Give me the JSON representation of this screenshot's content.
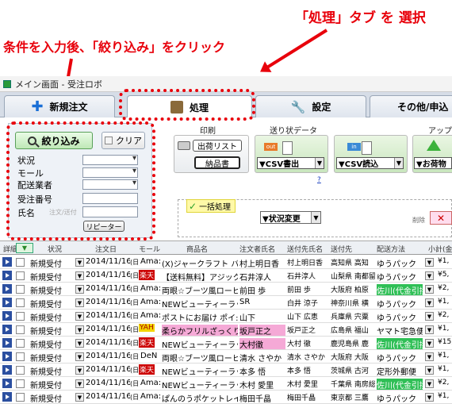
{
  "annotations": {
    "tab_instruction": "「処理」タブ を 選択",
    "filter_instruction": "条件を入力後、「絞り込み」をクリック"
  },
  "window": {
    "title": "メイン画面 - 受注ロボ"
  },
  "tabs": [
    {
      "label": "新規注文",
      "icon": "plus-icon"
    },
    {
      "label": "処理",
      "icon": "box-icon"
    },
    {
      "label": "設定",
      "icon": "wrench-icon"
    },
    {
      "label": "その他/申込",
      "icon": ""
    }
  ],
  "filter": {
    "filter_button": "絞り込み",
    "clear_button": "クリア",
    "status_label": "状況",
    "mall_label": "モール",
    "carrier_label": "配送業者",
    "order_number_label": "受注番号",
    "name_label": "氏名",
    "name_placeholder": "注文/送付",
    "repeater_button": "リピーター"
  },
  "print": {
    "section_label": "印刷",
    "list_button": "出荷リスト",
    "invoice_button": "納品書"
  },
  "shipping_data": {
    "section_label": "送り状データ",
    "export_label": "▼CSV書出",
    "import_label": "▼CSV読込",
    "out_badge": "out",
    "in_badge": "in",
    "help": "?"
  },
  "update": {
    "section_label": "アップ",
    "button": "▼お荷物"
  },
  "bulk": {
    "label": "一括処理",
    "select_value": "▼状況変更",
    "delete_label": "削除",
    "delete_button": "✕"
  },
  "grid": {
    "headers": [
      "詳細",
      "状況",
      "注文日",
      "モール",
      "商品名",
      "注文者氏名",
      "送付先氏名",
      "送付先",
      "配送方法",
      "小計(金"
    ],
    "rows": [
      {
        "status": "新規受付",
        "date": "2014/11/16",
        "dow": "(日)",
        "mall": "Ama:",
        "badge": "",
        "product": "(X)ジャークラフト バス:",
        "orderer": "村上明日香",
        "recipient": "村上明日香",
        "address": "高知県 高知",
        "method": "ゆうパック",
        "cod": false,
        "amount": "¥1,"
      },
      {
        "status": "新規受付",
        "date": "2014/11/16",
        "dow": "(日)",
        "mall": "楽天",
        "badge": "rakuten",
        "product": "【送料無料】アジックス:",
        "orderer": "石井淳人",
        "recipient": "石井淳人",
        "address": "山梨県 南都留",
        "method": "ゆうパック",
        "cod": false,
        "amount": "¥5,"
      },
      {
        "status": "新規受付",
        "date": "2014/11/16",
        "dow": "(日)",
        "mall": "Ama:",
        "badge": "",
        "product": "両眼☆ブーツ風ローヒ:",
        "orderer": "前田 歩",
        "recipient": "前田 歩",
        "address": "大阪府 柏原",
        "method": "佐川(代金引換)",
        "cod": true,
        "amount": "¥2,"
      },
      {
        "status": "新規受付",
        "date": "2014/11/16",
        "dow": "(日)",
        "mall": "Ama:",
        "badge": "",
        "product": "NEWビューティーラッシ:",
        "orderer": "SR",
        "recipient": "白井 涼子",
        "address": "神奈川県 横",
        "method": "ゆうパック",
        "cod": false,
        "amount": "¥1,"
      },
      {
        "status": "新規受付",
        "date": "2014/11/16",
        "dow": "(日)",
        "mall": "Ama:",
        "badge": "",
        "product": "ポストにお届け ポイ:",
        "orderer": "山下",
        "recipient": "山下 広恵",
        "address": "兵庫県 宍粟",
        "method": "ゆうパック",
        "cod": false,
        "amount": "¥2,"
      },
      {
        "status": "新規受付",
        "date": "2014/11/16",
        "dow": "(日)",
        "mall": "YAH",
        "badge": "yahoo",
        "product": "柔らかフリルざっくり編:",
        "orderer": "坂戸正之",
        "recipient": "坂戸正之",
        "address": "広島県 福山",
        "method": "ヤマト宅急便",
        "cod": false,
        "amount": "¥1,"
      },
      {
        "status": "新規受付",
        "date": "2014/11/16",
        "dow": "(日)",
        "mall": "楽天",
        "badge": "rakuten",
        "product": "NEWビューティーラッシ:",
        "orderer": "大村徹",
        "recipient": "大村 徹",
        "address": "鹿児島県 鹿",
        "method": "佐川(代金引換)",
        "cod": true,
        "amount": "¥15,"
      },
      {
        "status": "新規受付",
        "date": "2014/11/16",
        "dow": "(日)",
        "mall": "DeN",
        "badge": "",
        "product": "両眼☆ブーツ風ローヒ:",
        "orderer": "清水 さやか",
        "recipient": "清水 さやか",
        "address": "大阪府 大阪",
        "method": "ゆうパック",
        "cod": false,
        "amount": "¥1,"
      },
      {
        "status": "新規受付",
        "date": "2014/11/16",
        "dow": "(日)",
        "mall": "楽天",
        "badge": "rakuten",
        "product": "NEWビューティーラッシ:",
        "orderer": "本多 悟",
        "recipient": "本多 悟",
        "address": "茨城県 古河",
        "method": "定形外郵便",
        "cod": false,
        "amount": "¥1,"
      },
      {
        "status": "新規受付",
        "date": "2014/11/16",
        "dow": "(日)",
        "mall": "Ama:",
        "badge": "",
        "product": "NEWビューティーラッシ:",
        "orderer": "木村 愛里",
        "recipient": "木村 愛里",
        "address": "千葉県 南房総",
        "method": "佐川(代金引換)",
        "cod": true,
        "amount": "¥2,"
      },
      {
        "status": "新規受付",
        "date": "2014/11/16",
        "dow": "(日)",
        "mall": "Ama:",
        "badge": "",
        "product": "ぱんのうポケットレイン:",
        "orderer": "梅田千晶",
        "recipient": "梅田千晶",
        "address": "東京都 三鷹",
        "method": "ゆうパック",
        "cod": false,
        "amount": "¥1,"
      }
    ]
  },
  "colors": {
    "annotation_red": "#e8000b",
    "cod_green": "#2fbf56",
    "rakuten_red": "#c00000",
    "highlight_pink": "#f5a9d6"
  }
}
